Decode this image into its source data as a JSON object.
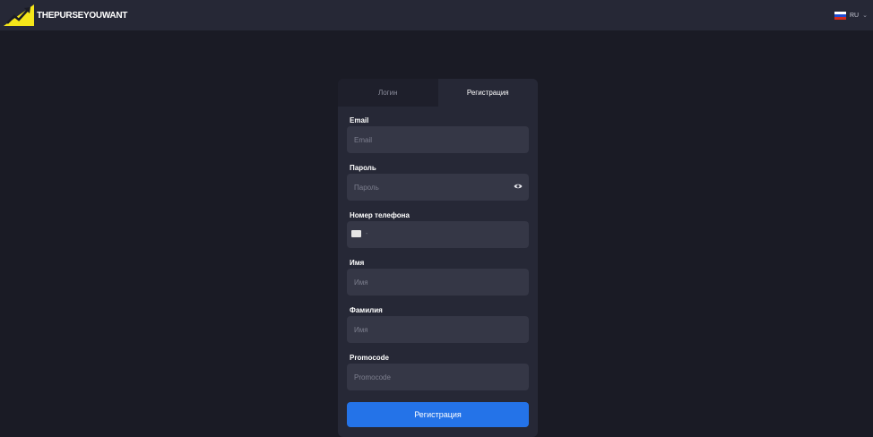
{
  "header": {
    "brand_name": "THEPURSEYOUWANT",
    "logo_icon": "rising-arrow-logo-icon",
    "language": {
      "code": "RU",
      "flag_icon": "russia-flag-icon",
      "chevron_icon": "chevron-down-icon"
    }
  },
  "colors": {
    "background": "#1a1b25",
    "topbar": "#262836",
    "card": "#262836",
    "input": "#353746",
    "accent": "#2473e8",
    "logo": "#f5e61a"
  },
  "tabs": [
    {
      "label": "Логин",
      "active": false
    },
    {
      "label": "Регистрация",
      "active": true
    }
  ],
  "form": {
    "email": {
      "label": "Email",
      "placeholder": "Email",
      "value": ""
    },
    "password": {
      "label": "Пароль",
      "placeholder": "Пароль",
      "value": "",
      "toggle_icon": "eye-icon"
    },
    "phone": {
      "label": "Номер телефона",
      "prefix": "-",
      "value": ""
    },
    "first_name": {
      "label": "Имя",
      "placeholder": "Имя",
      "value": ""
    },
    "last_name": {
      "label": "Фамилия",
      "placeholder": "Имя",
      "value": ""
    },
    "promocode": {
      "label": "Promocode",
      "placeholder": "Promocode",
      "value": ""
    },
    "submit_label": "Регистрация"
  }
}
